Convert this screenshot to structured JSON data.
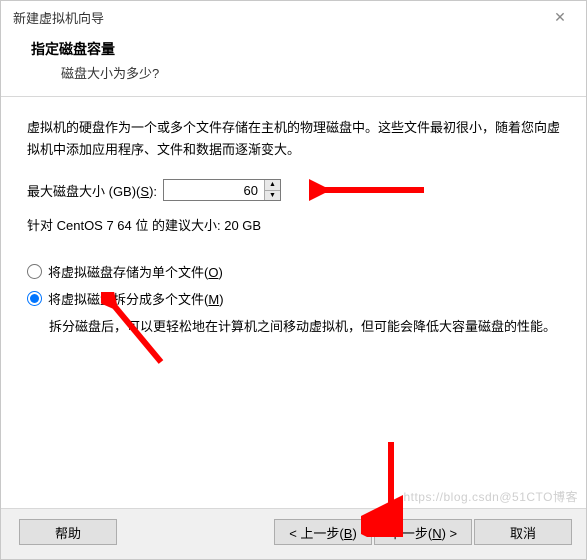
{
  "window": {
    "title": "新建虚拟机向导",
    "header_title": "指定磁盘容量",
    "header_subtitle": "磁盘大小为多少?"
  },
  "content": {
    "description": "虚拟机的硬盘作为一个或多个文件存储在主机的物理磁盘中。这些文件最初很小，随着您向虚拟机中添加应用程序、文件和数据而逐渐变大。",
    "disk_size_label_pre": "最大磁盘大小 (GB)(",
    "disk_size_hotkey": "S",
    "disk_size_label_post": "):",
    "disk_size_value": "60",
    "recommendation": "针对 CentOS 7 64 位 的建议大小: 20 GB",
    "radio_single_pre": "将虚拟磁盘存储为单个文件(",
    "radio_single_hotkey": "O",
    "radio_single_post": ")",
    "radio_split_pre": "将虚拟磁盘拆分成多个文件(",
    "radio_split_hotkey": "M",
    "radio_split_post": ")",
    "radio_split_desc": "拆分磁盘后，可以更轻松地在计算机之间移动虚拟机，但可能会降低大容量磁盘的性能。",
    "selected_option": "split"
  },
  "footer": {
    "help": "帮助",
    "back_pre": "< 上一步(",
    "back_hotkey": "B",
    "back_post": ")",
    "next_pre": "下一步(",
    "next_hotkey": "N",
    "next_post": ") >",
    "cancel": "取消"
  },
  "watermark": "https://blog.csdn@51CTO博客"
}
